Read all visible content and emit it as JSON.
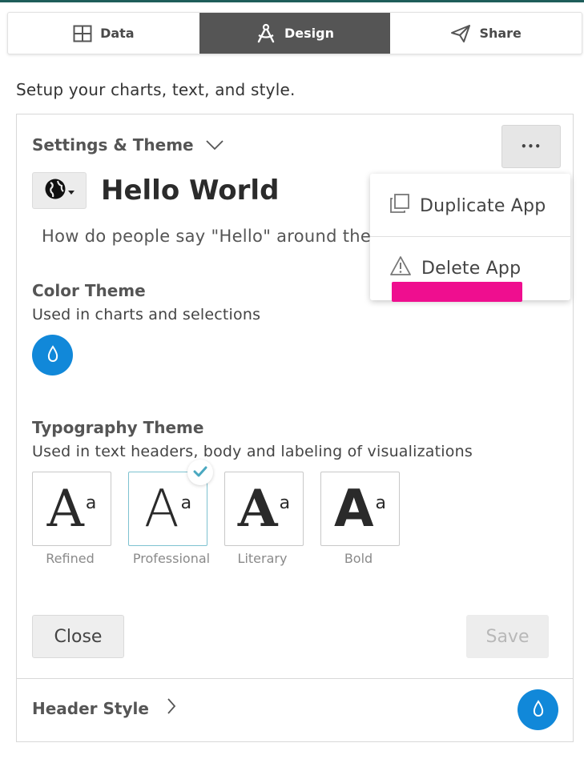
{
  "tabs": [
    {
      "label": "Data",
      "icon": "grid-icon",
      "active": false
    },
    {
      "label": "Design",
      "icon": "drafting-compass-icon",
      "active": true
    },
    {
      "label": "Share",
      "icon": "paper-plane-icon",
      "active": false
    }
  ],
  "intro_text": "Setup your charts, text, and style.",
  "settings": {
    "title": "Settings & Theme",
    "more_label": "•••"
  },
  "app": {
    "title": "Hello World",
    "description": "How do people say \"Hello\" around the world"
  },
  "color_theme": {
    "title": "Color Theme",
    "subtitle": "Used in charts and selections",
    "color": "#1188d9"
  },
  "typography_theme": {
    "title": "Typography Theme",
    "subtitle": "Used in text headers, body and labeling of visualizations",
    "glyph_big": "A",
    "glyph_small": "a",
    "options": [
      {
        "label": "Refined",
        "selected": false
      },
      {
        "label": "Professional",
        "selected": true
      },
      {
        "label": "Literary",
        "selected": false
      },
      {
        "label": "Bold",
        "selected": false
      }
    ]
  },
  "buttons": {
    "close": "Close",
    "save": "Save"
  },
  "header_style": {
    "title": "Header Style"
  },
  "menu": {
    "duplicate": "Duplicate App",
    "delete": "Delete App"
  },
  "colors": {
    "active_tab": "#555555",
    "accent_blue": "#1188d9",
    "highlight": "#ef0e8f",
    "check": "#4aa8c0"
  }
}
